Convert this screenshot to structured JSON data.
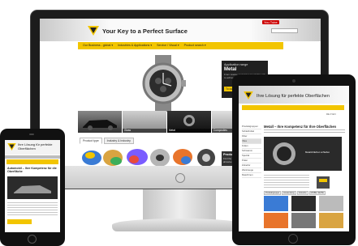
{
  "desktop": {
    "site_title": "Your Key to a Perfect Surface",
    "youtube_label": "You Tube",
    "nav_items": [
      "Our Business - global ▾",
      "Industries & Applications ▾",
      "Service / Visual ▾",
      "Product search ▾"
    ],
    "hero_panel": {
      "eyebrow": "Application range",
      "title": "Metal",
      "body": "From coarse material removal through to achieving the finishing processes",
      "button": "To our Metal solutions"
    },
    "strip_captions": [
      "",
      "Glass",
      "Metal",
      "Composites"
    ],
    "tabs": [
      "Product type",
      "Industry & Industry"
    ],
    "search_panel": {
      "title": "Product search",
      "body": "Find the perfect abrasive"
    }
  },
  "tablet": {
    "site_title": "Ihre Lösung für perfekte Oberflächen",
    "util": "DE ▾  EN",
    "side_items": [
      "Produktgruppen",
      "Schleifmittel",
      "Fiber",
      "Vlies",
      "Folien",
      "Schwamm",
      "Spezial",
      "Polier",
      "Zubehör",
      "Werkzeuge",
      "Maschinen"
    ],
    "heading": "Metall – Ihre Kompetenz für Ihre Oberflächen",
    "image_text": "Metall-Flächen schleifen",
    "tabs": [
      "Produktgruppe",
      "Anwendung",
      "Industrie",
      "MOBIL SEITE"
    ]
  },
  "phone": {
    "site_title": "Ihre Lösung für perfekte Oberflächen",
    "heading": "Automobil – Ihre Kompetenz für die Oberfläche"
  },
  "colors": {
    "accent": "#f2c500",
    "dark": "#202020"
  }
}
